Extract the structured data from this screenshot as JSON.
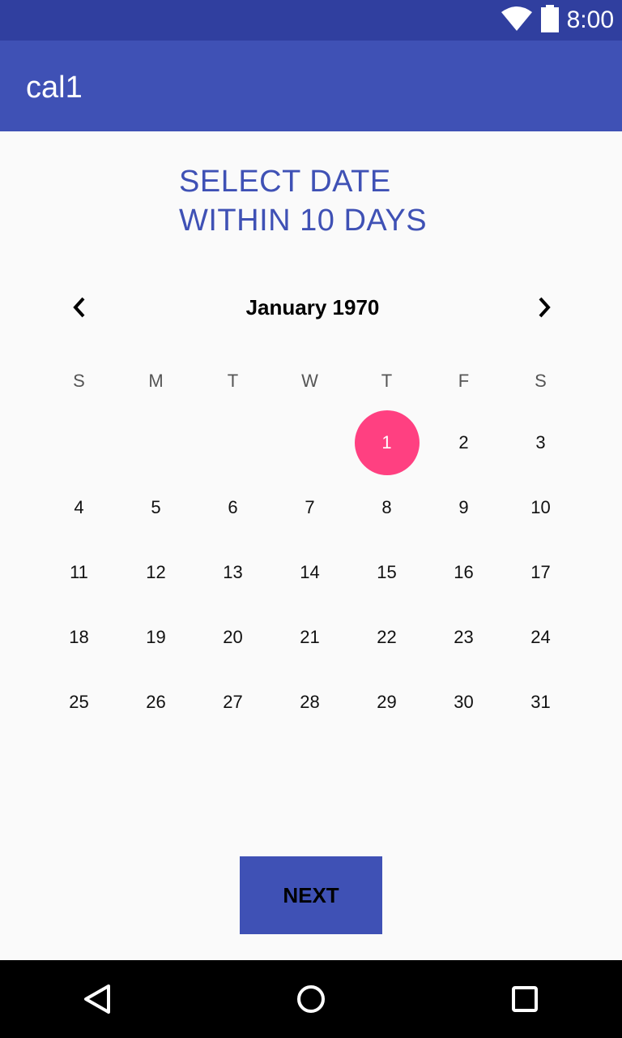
{
  "status_bar": {
    "time": "8:00",
    "icons": [
      "wifi-icon",
      "battery-icon"
    ]
  },
  "app_bar": {
    "title": "cal1"
  },
  "heading": {
    "line1": "SELECT DATE",
    "line2": "WITHIN 10 DAYS"
  },
  "calendar": {
    "month_label": "January 1970",
    "weekdays": [
      "S",
      "M",
      "T",
      "W",
      "T",
      "F",
      "S"
    ],
    "weeks": [
      [
        "",
        "",
        "",
        "",
        "1",
        "2",
        "3"
      ],
      [
        "4",
        "5",
        "6",
        "7",
        "8",
        "9",
        "10"
      ],
      [
        "11",
        "12",
        "13",
        "14",
        "15",
        "16",
        "17"
      ],
      [
        "18",
        "19",
        "20",
        "21",
        "22",
        "23",
        "24"
      ],
      [
        "25",
        "26",
        "27",
        "28",
        "29",
        "30",
        "31"
      ]
    ],
    "selected_day": "1"
  },
  "buttons": {
    "next_label": "NEXT"
  },
  "colors": {
    "status_bar": "#303f9f",
    "primary": "#3f51b5",
    "accent": "#ff4081",
    "nav_bar": "#000000"
  },
  "nav_bar": {
    "icons": [
      "back-icon",
      "home-icon",
      "recents-icon"
    ]
  }
}
